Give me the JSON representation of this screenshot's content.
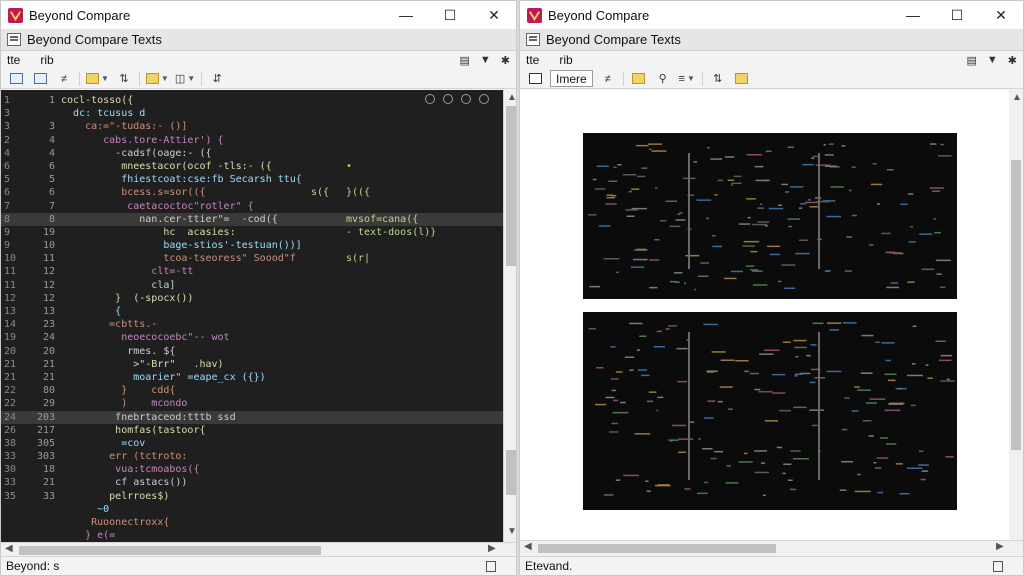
{
  "left_window": {
    "title": "Beyond Compare",
    "tab_label": "Beyond Compare  Texts",
    "menu": [
      "tte",
      "rib"
    ],
    "status_text": "Beyond: s",
    "line_numbers": [
      [
        "1",
        "1"
      ],
      [
        "3",
        ""
      ],
      [
        "3",
        "3"
      ],
      [
        "2",
        "4"
      ],
      [
        "4",
        "4"
      ],
      [
        "6",
        "6"
      ],
      [
        "5",
        "5"
      ],
      [
        "6",
        "6"
      ],
      [
        "7",
        "7"
      ],
      [
        "8",
        "8"
      ],
      [
        "9",
        "19"
      ],
      [
        "9",
        "10"
      ],
      [
        "10",
        "11"
      ],
      [
        "11",
        "12"
      ],
      [
        "11",
        "12"
      ],
      [
        "12",
        "12"
      ],
      [
        "13",
        "13"
      ],
      [
        "14",
        "23"
      ],
      [
        "19",
        "24"
      ],
      [
        "20",
        "20"
      ],
      [
        "21",
        "21"
      ],
      [
        "21",
        "21"
      ],
      [
        "22",
        "80"
      ],
      [
        "22",
        "29"
      ],
      [
        "24",
        "203"
      ],
      [
        "26",
        "217"
      ],
      [
        "38",
        "305"
      ],
      [
        "33",
        "303"
      ],
      [
        "30",
        "18"
      ],
      [
        "33",
        "21"
      ],
      [
        "35",
        "33"
      ]
    ],
    "code_lines": [
      "cocl-tosso({",
      "  dc: tcusus d",
      "    ca:=\"-tudas:- ()]",
      "       cabs.tore-Attier') {",
      "         -cadsf(oage:- ({",
      "          mneestacor(ocof -tls:- ({",
      "          fhiestcoat:cse:fb Secarsh ttu{",
      "          bcess.s=sor(({",
      "           caetacoctoc\"rotler\" {",
      "             nan.cer-ttier\"=  -cod({",
      "                 hc  acasies:",
      "                 bage-stios'-testuan())]",
      "                 tcoa-tseoress\" Soood\"f",
      "               clt=-tt",
      "               cla]",
      "         }  (-spocx())",
      "         {",
      "        =cbtts.-",
      "          neoecocoebc\"-- wot",
      "           rmes. ${",
      "            >\"-Brr\"   .hav)",
      "            moarier\" =eape_cx ({})",
      "          }    cdd{",
      "          )    mcondo",
      "         fnebrtaceod:tttb ssd",
      "         homfas(tastoor{",
      "          =cov",
      "        err (tctroto:",
      "         vua:tcmoabos({",
      "         cf astacs())",
      "        pelrroes$)"
    ],
    "code_lines_tail": [
      "      ~0",
      "     Ruoonectroxx{",
      "    } e(="
    ],
    "side_annotations": [
      "•",
      "s({",
      "}(({",
      "mvsof=cana({",
      "- text-doos(l)}",
      "s(r|"
    ],
    "highlight_rows": [
      9,
      24
    ]
  },
  "right_window": {
    "title": "Beyond Compare",
    "tab_label": "Beyond Compare  Texts",
    "menu": [
      "tte",
      "rib"
    ],
    "toolbar_label": "Imere",
    "status_text": "Etevand."
  },
  "colors": {
    "editor_bg": "#1f1f1f",
    "highlight_bg": "#3a3a3a",
    "keyword": "#c586c0",
    "function": "#dcdcaa",
    "string": "#ce9178",
    "variable": "#9cdcfe"
  },
  "icons": {
    "app": "beyond-compare-logo",
    "minimize": "minimize-icon",
    "maximize": "maximize-icon",
    "close": "close-icon"
  }
}
